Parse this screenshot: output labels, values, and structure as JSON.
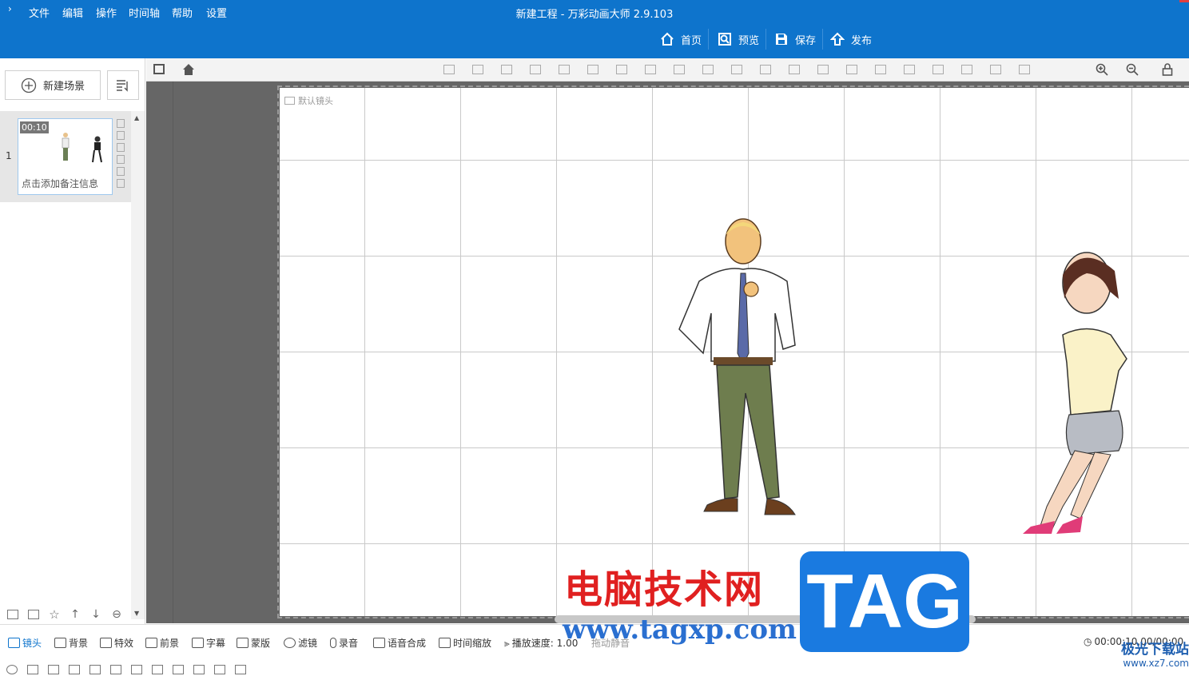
{
  "window": {
    "title": "新建工程 - 万彩动画大师 2.9.103",
    "menu": [
      "文件",
      "编辑",
      "操作",
      "时间轴",
      "帮助",
      "设置"
    ]
  },
  "topnav": {
    "home": "首页",
    "preview": "预览",
    "save": "保存",
    "publish": "发布"
  },
  "left_panel": {
    "new_scene": "新建场景",
    "scenes": [
      {
        "index": "1",
        "time": "00:10",
        "note": "点击添加备注信息"
      }
    ]
  },
  "canvas": {
    "camera_label": "默认镜头"
  },
  "bottom_bar": {
    "items": [
      "镜头",
      "背景",
      "特效",
      "前景",
      "字幕",
      "蒙版",
      "滤镜",
      "录音",
      "语音合成",
      "时间缩放",
      "播放速度: 1.00",
      "拖动静音"
    ],
    "time_display": "00:00:10.00/00:00"
  },
  "watermark": {
    "cn_text": "电脑技术网",
    "url": "www.tagxp.com",
    "tag": "TAG",
    "site_cn": "极光下载站",
    "site_url": "www.xz7.com"
  },
  "colors": {
    "title_bar": "#0e74cc",
    "work_bg": "#666666",
    "accent": "#0e74cc"
  }
}
